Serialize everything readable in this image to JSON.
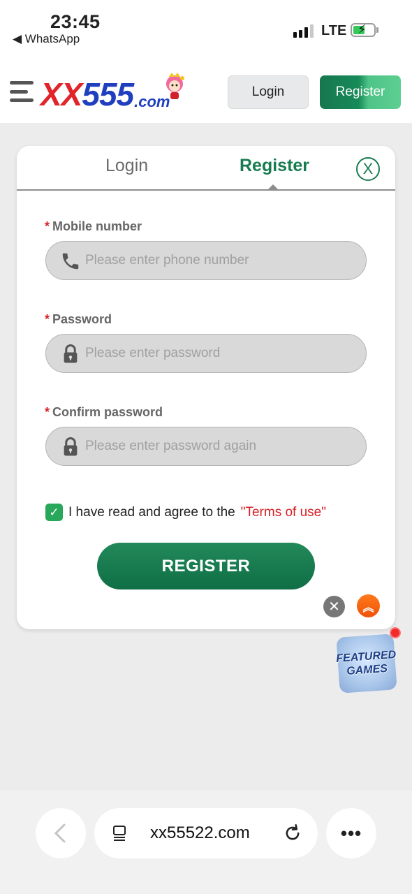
{
  "status_bar": {
    "time": "23:45",
    "back_app": "◀ WhatsApp",
    "network": "LTE"
  },
  "header": {
    "logo_xx": "XX",
    "logo_555": "555",
    "logo_com": ".com",
    "login_label": "Login",
    "register_label": "Register"
  },
  "modal": {
    "tab_login": "Login",
    "tab_register": "Register",
    "close_symbol": "X",
    "fields": [
      {
        "label": "Mobile number",
        "placeholder": "Please enter phone number",
        "value": "",
        "icon": "phone-icon"
      },
      {
        "label": "Password",
        "placeholder": "Please enter password",
        "value": "",
        "icon": "lock-icon"
      },
      {
        "label": "Confirm password",
        "placeholder": "Please enter password again",
        "value": "",
        "icon": "lock-icon"
      }
    ],
    "required_mark": "*",
    "agree_text": "I have read and agree to the",
    "terms_link": "\"Terms of use\"",
    "agree_checked": true,
    "submit_label": "REGISTER"
  },
  "featured_games": {
    "line1": "FEATURED",
    "line2": "GAMES"
  },
  "browser": {
    "url": "xx55522.com"
  },
  "colors": {
    "brand_green": "#177b4f",
    "required_red": "#d61f26",
    "logo_red": "#e1242a",
    "logo_blue": "#1f3fbf",
    "scroll_top_orange": "#f0520a"
  }
}
